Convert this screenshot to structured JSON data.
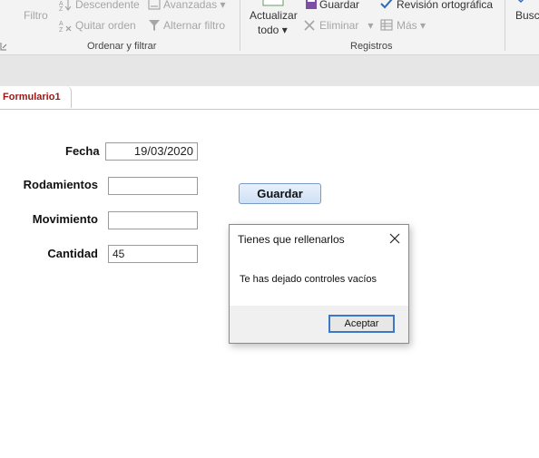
{
  "ribbon": {
    "filter_label": "Filtro",
    "sort_desc_label": "Descendente",
    "clear_sort_label": "Quitar orden",
    "advanced_label": "Avanzadas",
    "toggle_filter_label": "Alternar filtro",
    "group_sort_filter": "Ordenar y filtrar",
    "refresh_label_1": "Actualizar",
    "refresh_label_2": "todo",
    "save_label": "Guardar",
    "delete_label": "Eliminar",
    "spelling_label": "Revisión ortográfica",
    "more_label": "Más",
    "group_records": "Registros",
    "find_label": "Buscar"
  },
  "tabs": [
    {
      "label": "Formulario1"
    }
  ],
  "form": {
    "fecha_label": "Fecha",
    "fecha_value": "19/03/2020",
    "rodamientos_label": "Rodamientos",
    "rodamientos_value": "",
    "movimiento_label": "Movimiento",
    "movimiento_value": "",
    "cantidad_label": "Cantidad",
    "cantidad_value": "45",
    "save_button": "Guardar"
  },
  "dialog": {
    "title": "Tienes que rellenarlos",
    "message": "Te has dejado controles vacíos",
    "ok_button": "Aceptar"
  },
  "colors": {
    "tab_label": "#a31515",
    "dialog_button_border": "#3c78c8"
  }
}
